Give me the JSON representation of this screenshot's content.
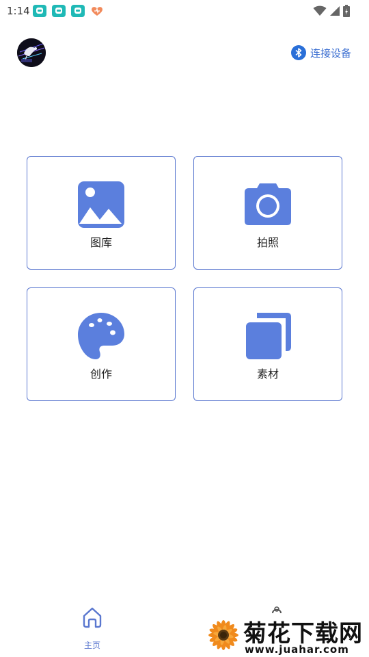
{
  "status_bar": {
    "time": "1:14",
    "notification_icons": [
      "app-notification-icon",
      "app-notification-icon",
      "app-notification-icon",
      "heart-notification-icon"
    ],
    "system_icons": [
      "wifi-icon",
      "cellular-signal-icon",
      "battery-charging-icon"
    ]
  },
  "header": {
    "avatar_icon": "profile-avatar-image",
    "connect_icon": "bluetooth-icon",
    "connect_label": "连接设备"
  },
  "grid": {
    "items": [
      {
        "label": "图库",
        "icon": "gallery-image-icon"
      },
      {
        "label": "拍照",
        "icon": "camera-icon"
      },
      {
        "label": "创作",
        "icon": "palette-icon"
      },
      {
        "label": "素材",
        "icon": "copy-layers-icon"
      }
    ]
  },
  "bottom_nav": {
    "home_icon": "home-icon",
    "home_label": "主页"
  },
  "watermark": {
    "logo": "chrysanthemum-flower-logo",
    "title": "菊花下载网",
    "url": "www.juahar.com"
  },
  "colors": {
    "accent": "#5a77cf",
    "icon_fill": "#5b7fdd",
    "link": "#3c6fd1",
    "bluetooth": "#2a6fd8"
  }
}
